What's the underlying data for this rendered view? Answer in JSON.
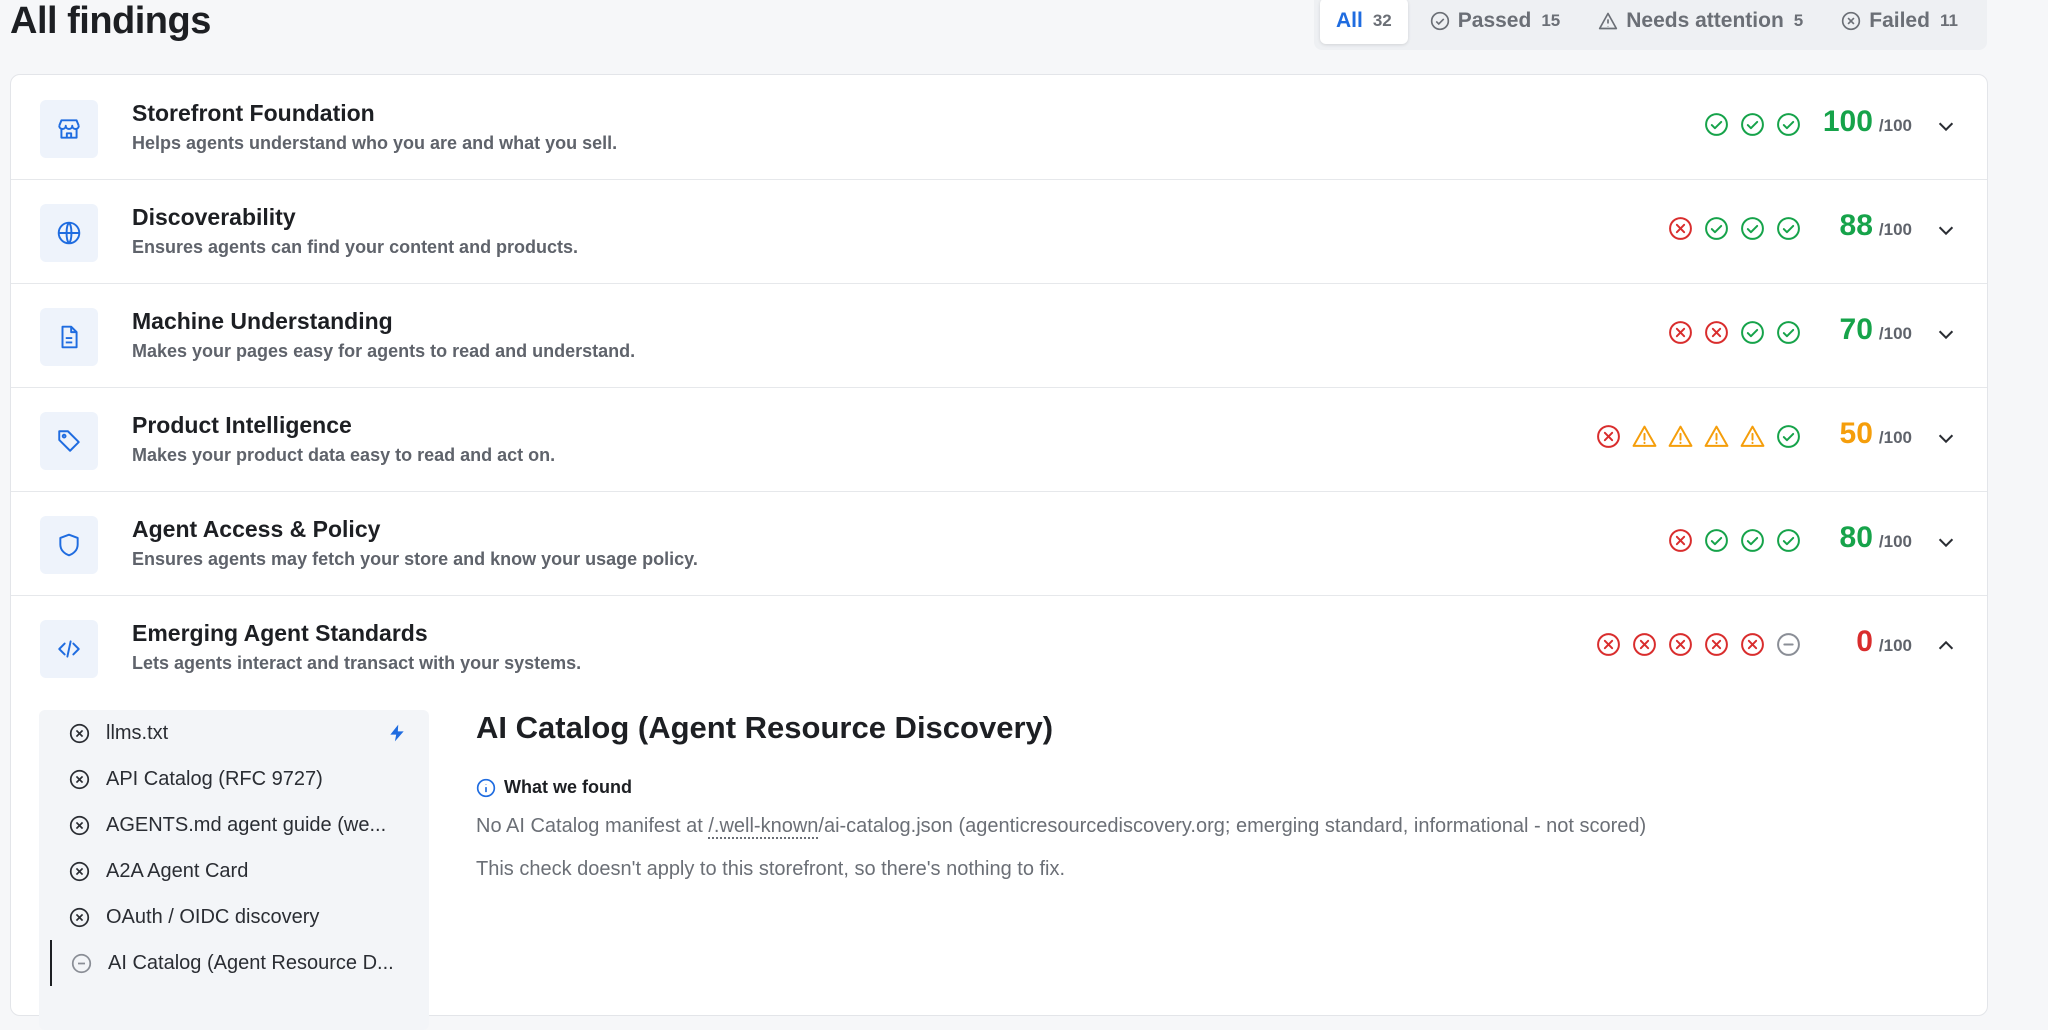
{
  "page": {
    "title": "All findings"
  },
  "filters": [
    {
      "label": "All",
      "count": "32",
      "active": true
    },
    {
      "label": "Passed",
      "count": "15",
      "icon": "check-circle-icon"
    },
    {
      "label": "Needs attention",
      "count": "5",
      "icon": "warning-icon"
    },
    {
      "label": "Failed",
      "count": "11",
      "icon": "x-circle-icon"
    }
  ],
  "colors": {
    "pass": "#16a34a",
    "warn": "#f59e0b",
    "fail": "#d92d2d",
    "neutral": "#8a8e96",
    "accent": "#1f6ce0"
  },
  "categories": [
    {
      "title": "Storefront Foundation",
      "desc": "Helps agents understand who you are and what you sell.",
      "icon": "storefront-icon",
      "statuses": [
        "pass",
        "pass",
        "pass"
      ],
      "score": "100",
      "denom": "/100",
      "expanded": false
    },
    {
      "title": "Discoverability",
      "desc": "Ensures agents can find your content and products.",
      "icon": "globe-icon",
      "statuses": [
        "fail",
        "pass",
        "pass",
        "pass"
      ],
      "score": "88",
      "denom": "/100",
      "expanded": false
    },
    {
      "title": "Machine Understanding",
      "desc": "Makes your pages easy for agents to read and understand.",
      "icon": "document-icon",
      "statuses": [
        "fail",
        "fail",
        "pass",
        "pass"
      ],
      "score": "70",
      "denom": "/100",
      "expanded": false
    },
    {
      "title": "Product Intelligence",
      "desc": "Makes your product data easy to read and act on.",
      "icon": "tag-icon",
      "statuses": [
        "fail",
        "warn",
        "warn",
        "warn",
        "warn",
        "pass"
      ],
      "score": "50",
      "denom": "/100",
      "expanded": false
    },
    {
      "title": "Agent Access & Policy",
      "desc": "Ensures agents may fetch your store and know your usage policy.",
      "icon": "shield-icon",
      "statuses": [
        "fail",
        "pass",
        "pass",
        "pass"
      ],
      "score": "80",
      "denom": "/100",
      "expanded": false
    },
    {
      "title": "Emerging Agent Standards",
      "desc": "Lets agents interact and transact with your systems.",
      "icon": "code-icon",
      "statuses": [
        "fail",
        "fail",
        "fail",
        "fail",
        "fail",
        "neutral"
      ],
      "score": "0",
      "denom": "/100",
      "expanded": true
    }
  ],
  "checks": [
    {
      "label": "llms.txt",
      "status": "fail",
      "quick_fix": true
    },
    {
      "label": "API Catalog (RFC 9727)",
      "status": "fail"
    },
    {
      "label": "AGENTS.md agent guide (we...",
      "status": "fail"
    },
    {
      "label": "A2A Agent Card",
      "status": "fail"
    },
    {
      "label": "OAuth / OIDC discovery",
      "status": "fail"
    },
    {
      "label": "AI Catalog (Agent Resource D...",
      "status": "neutral",
      "selected": true
    }
  ],
  "detail": {
    "title": "AI Catalog (Agent Resource Discovery)",
    "found_heading": "What we found",
    "found_prefix": "No AI Catalog manifest at ",
    "found_link": "/.well-known",
    "found_suffix": "/ai-catalog.json (agenticresourcediscovery.org; emerging standard, informational - not scored)",
    "not_applicable": "This check doesn't apply to this storefront, so there's nothing to fix."
  }
}
